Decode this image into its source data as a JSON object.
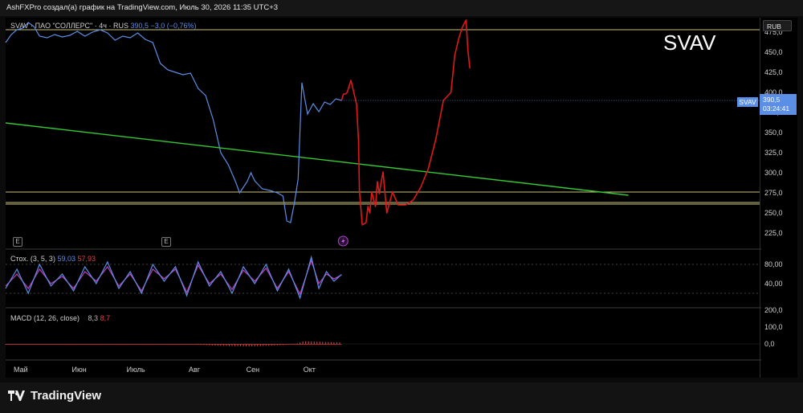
{
  "header": {
    "caption": "AshFXPro создал(а) график на TradingView.com, Июль 30, 2026 11:35 UTC+3"
  },
  "symbol_title": "SVAV",
  "legend": {
    "main_prefix": "SVAV · ПАО \"СОЛЛЕРС\" · 4ч · RUS",
    "main_value": "390,5 −3,0 (−0,76%)",
    "stoch_prefix": "Стох. (3, 5, 3)",
    "stoch_k": "59,03",
    "stoch_d": "57,93",
    "macd_prefix": "MACD (12, 26, close)",
    "macd_a": "8,3",
    "macd_b": "8,7"
  },
  "currency_badge": "RUB",
  "price_tag": {
    "symbol": "SVAV",
    "price": "390,5",
    "countdown": "03:24:41"
  },
  "footer": {
    "brand": "TradingView"
  },
  "colors": {
    "price_line": "#5b8ee6",
    "trend_green": "#35c832",
    "hlines": "#c8c07a",
    "projection": "#e01818",
    "stoch_k": "#5b8ee6",
    "stoch_d": "#c040c0",
    "macd_hist": "#e05050"
  },
  "chart_data": [
    {
      "type": "line",
      "title": "SVAV · ПАО \"СОЛЛЕРС\" · 4ч · RUS",
      "x_ticks": [
        "Май",
        "Июн",
        "Июль",
        "Авг",
        "Сен",
        "Окт"
      ],
      "y_ticks": [
        "225,0",
        "250,0",
        "275,0",
        "300,0",
        "325,0",
        "350,0",
        "375,0",
        "400,0",
        "425,0",
        "450,0",
        "475,0"
      ],
      "ylim": [
        212,
        490
      ],
      "series": [
        {
          "name": "SVAV",
          "x": [
            0,
            3,
            6,
            9,
            12,
            15,
            18,
            22,
            26,
            30,
            34,
            38,
            42,
            46,
            50,
            54,
            58,
            62,
            66,
            70,
            74,
            78,
            82,
            86,
            90,
            94,
            98,
            102,
            106,
            110,
            114,
            118,
            122,
            124,
            126,
            128,
            130,
            132,
            136,
            140,
            144,
            147,
            149,
            151,
            153,
            155,
            157,
            160,
            163,
            166,
            169,
            172,
            175,
            178
          ],
          "y": [
            462,
            472,
            478,
            480,
            487,
            482,
            470,
            468,
            472,
            469,
            471,
            476,
            470,
            475,
            478,
            474,
            465,
            470,
            468,
            474,
            466,
            462,
            436,
            428,
            425,
            422,
            424,
            405,
            396,
            366,
            325,
            310,
            288,
            275,
            282,
            289,
            300,
            290,
            280,
            278,
            275,
            271,
            240,
            238,
            262,
            292,
            412,
            373,
            386,
            376,
            388,
            385,
            392,
            390
          ]
        }
      ],
      "hlines": [
        478,
        276,
        263,
        261
      ],
      "trendline": {
        "from": [
          0,
          362
        ],
        "to": [
          330,
          272
        ]
      },
      "projection": {
        "x": [
          178,
          179,
          180,
          181,
          183,
          185,
          186,
          187,
          187.5,
          189,
          191,
          192,
          193,
          194,
          196,
          197,
          198,
          199,
          200,
          202,
          205,
          208,
          212,
          216,
          220,
          224,
          228,
          232,
          236,
          238,
          240,
          242,
          244,
          245,
          246
        ],
        "y": [
          390,
          398,
          398,
          400,
          415,
          395,
          385,
          340,
          277,
          235,
          238,
          258,
          250,
          276,
          258,
          289,
          274,
          288,
          301,
          250,
          276,
          260,
          260,
          266,
          282,
          305,
          342,
          390,
          400,
          446,
          466,
          481,
          490,
          452,
          430
        ]
      }
    },
    {
      "type": "line",
      "title": "Стох. (3, 5, 3)",
      "y_ticks": [
        "40,00",
        "80,00"
      ],
      "ylim": [
        0,
        100
      ],
      "series": [
        {
          "name": "%K",
          "x": [
            0,
            6,
            12,
            18,
            24,
            30,
            36,
            42,
            48,
            54,
            60,
            66,
            72,
            78,
            84,
            90,
            96,
            102,
            108,
            114,
            120,
            126,
            132,
            138,
            144,
            150,
            156,
            162,
            166,
            170,
            174,
            178
          ],
          "y": [
            30,
            70,
            20,
            80,
            35,
            60,
            25,
            75,
            40,
            85,
            30,
            65,
            20,
            80,
            45,
            75,
            15,
            85,
            35,
            65,
            20,
            75,
            40,
            80,
            25,
            70,
            10,
            95,
            30,
            65,
            45,
            59
          ]
        },
        {
          "name": "%D",
          "x": [
            0,
            6,
            12,
            18,
            24,
            30,
            36,
            42,
            48,
            54,
            60,
            66,
            72,
            78,
            84,
            90,
            96,
            102,
            108,
            114,
            120,
            126,
            132,
            138,
            144,
            150,
            156,
            162,
            166,
            170,
            174,
            178
          ],
          "y": [
            35,
            60,
            30,
            70,
            40,
            55,
            30,
            65,
            45,
            75,
            35,
            60,
            25,
            70,
            50,
            70,
            22,
            78,
            40,
            60,
            28,
            68,
            45,
            72,
            30,
            65,
            18,
            88,
            40,
            60,
            50,
            58
          ]
        }
      ],
      "levels": [
        80,
        20
      ]
    },
    {
      "type": "bar",
      "title": "MACD (12, 26, close)",
      "y_ticks": [
        "0,0",
        "100,0",
        "200,0"
      ],
      "ylim": [
        -60,
        210
      ],
      "bars": {
        "start": 0,
        "end": 178,
        "step": 1.5
      },
      "hist_shape": [
        [
          0,
          -4
        ],
        [
          100,
          -4
        ],
        [
          110,
          -9
        ],
        [
          130,
          -15
        ],
        [
          148,
          -6
        ],
        [
          155,
          4
        ],
        [
          158,
          16
        ],
        [
          178,
          8
        ]
      ]
    }
  ]
}
